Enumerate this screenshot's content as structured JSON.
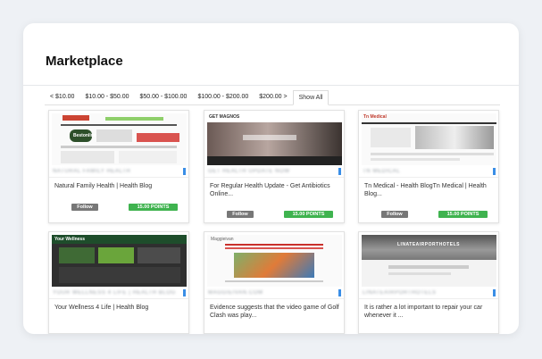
{
  "page": {
    "title": "Marketplace"
  },
  "tabs": [
    {
      "label": "< $10.00",
      "active": false
    },
    {
      "label": "$10.00 - $50.00",
      "active": false
    },
    {
      "label": "$50.00 - $100.00",
      "active": false
    },
    {
      "label": "$100.00 - $200.00",
      "active": false
    },
    {
      "label": "$200.00 >",
      "active": false
    },
    {
      "label": "Show All",
      "active": true
    }
  ],
  "cards": [
    {
      "site_name": "NATURAL FAMILY HEALTH",
      "title": "Natural Family Health | Health Blog",
      "follow_label": "Follow",
      "points": "15.00 POINTS",
      "thumb_logo": "Bestonline"
    },
    {
      "site_name": "GET HEALTH UPDATE NOW",
      "title": "For Regular Health Update - Get Antibiotics Online...",
      "follow_label": "Follow",
      "points": "15.00 POINTS",
      "thumb_logo": "GET MAGNOS"
    },
    {
      "site_name": "TN MEDICAL",
      "title": "Tn Medical - Health BlogTn Medical | Health Blog...",
      "follow_label": "Follow",
      "points": "15.00 POINTS",
      "thumb_logo": "Tn Medical"
    },
    {
      "site_name": "YOUR WELLNESS 4 LIFE | HEALTH BLOG",
      "title": "Your Wellness 4 Life | Health Blog",
      "thumb_logo": "Your Wellness"
    },
    {
      "site_name": "MAGGIEIVAN.COM",
      "title": "Evidence suggests that the video game of Golf Clash was play...",
      "thumb_logo": "Maggieivan"
    },
    {
      "site_name": "LINATEAIRPORTHOTELS",
      "title": "It is rather a lot important to repair your car whenever it ...",
      "thumb_logo": "LINATEAIRPORTHOTELS"
    }
  ],
  "colors": {
    "follow": "#777777",
    "points": "#3fb34f",
    "accent": "#3a8ee6"
  }
}
